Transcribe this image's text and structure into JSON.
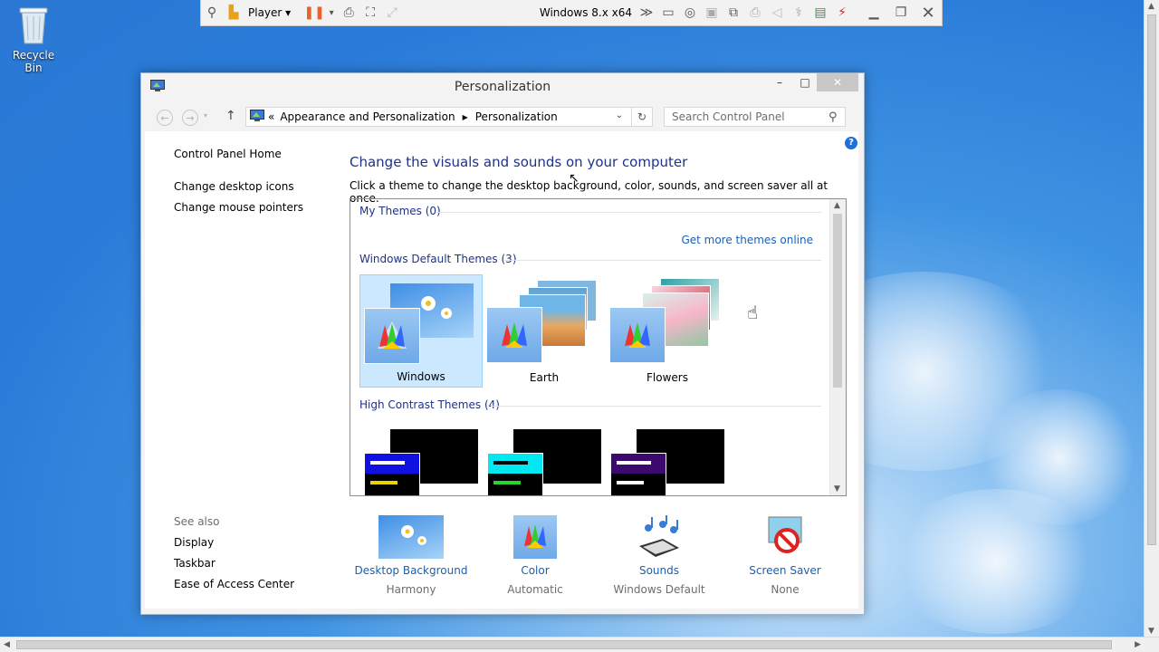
{
  "desktop": {
    "recycle_bin_label": "Recycle Bin"
  },
  "vm_toolbar": {
    "player_label": "Player",
    "vm_name": "Windows 8.x x64",
    "more": "≫"
  },
  "window": {
    "title": "Personalization",
    "controls": {
      "minimize": "–",
      "maximize": "□",
      "close": "✕"
    }
  },
  "navbar": {
    "back": "←",
    "forward": "→",
    "up": "↑",
    "breadcrumb_prefix": "«",
    "breadcrumb": [
      "Appearance and Personalization",
      "Personalization"
    ],
    "search_placeholder": "Search Control Panel"
  },
  "left_nav": {
    "home": "Control Panel Home",
    "links": [
      "Change desktop icons",
      "Change mouse pointers"
    ],
    "see_also_label": "See also",
    "see_also": [
      "Display",
      "Taskbar",
      "Ease of Access Center"
    ]
  },
  "main": {
    "heading": "Change the visuals and sounds on your computer",
    "description": "Click a theme to change the desktop background, color, sounds, and screen saver all at once.",
    "help": "?"
  },
  "themes": {
    "my_themes": "My Themes (0)",
    "get_more_link": "Get more themes online",
    "windows_default": "Windows Default Themes (3)",
    "default_items": [
      {
        "name": "Windows",
        "selected": true
      },
      {
        "name": "Earth",
        "selected": false
      },
      {
        "name": "Flowers",
        "selected": false
      }
    ],
    "high_contrast": "High Contrast Themes (4)",
    "high_contrast_colors": [
      "#1010e0",
      "#00e8f0",
      "#3c0a6e"
    ]
  },
  "bottom_bar": [
    {
      "label": "Desktop Background",
      "value": "Harmony"
    },
    {
      "label": "Color",
      "value": "Automatic"
    },
    {
      "label": "Sounds",
      "value": "Windows Default"
    },
    {
      "label": "Screen Saver",
      "value": "None"
    }
  ]
}
